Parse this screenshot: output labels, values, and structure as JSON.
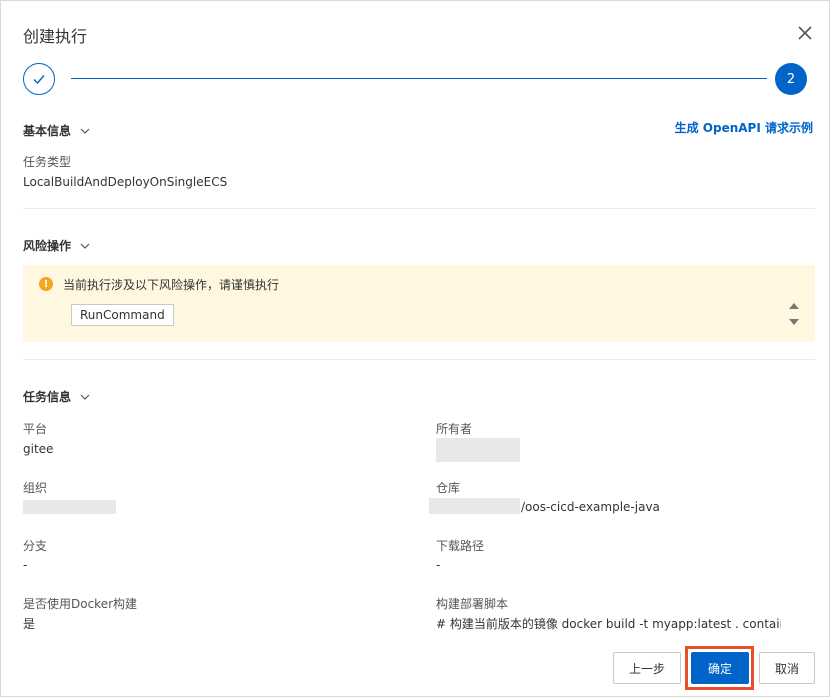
{
  "dialog": {
    "title": "创建执行",
    "close_icon": "close-icon"
  },
  "steps": {
    "step1_icon": "check-icon",
    "step2_label": "2"
  },
  "basic_info": {
    "title": "基本信息",
    "openapi_link": "生成 OpenAPI 请求示例",
    "task_type_label": "任务类型",
    "task_type_value": "LocalBuildAndDeployOnSingleECS"
  },
  "risk": {
    "title": "风险操作",
    "warning_text": "当前执行涉及以下风险操作，请谨慎执行",
    "tag": "RunCommand"
  },
  "task_info": {
    "title": "任务信息",
    "platform_label": "平台",
    "platform_value": "gitee",
    "owner_label": "所有者",
    "org_label": "组织",
    "repo_label": "仓库",
    "repo_value_suffix": "/oos-cicd-example-java",
    "branch_label": "分支",
    "branch_value": "-",
    "download_path_label": "下载路径",
    "download_path_value": "-",
    "docker_label": "是否使用Docker构建",
    "docker_value": "是",
    "script_label": "构建部署脚本",
    "script_value": "# 构建当前版本的镜像 docker build -t myapp:latest . container..."
  },
  "footer": {
    "prev_label": "上一步",
    "ok_label": "确定",
    "cancel_label": "取消"
  },
  "colors": {
    "primary": "#0064c8",
    "warning_bg": "#fff7e0",
    "warning_icon": "#f5a623",
    "highlight": "#e8502a"
  }
}
